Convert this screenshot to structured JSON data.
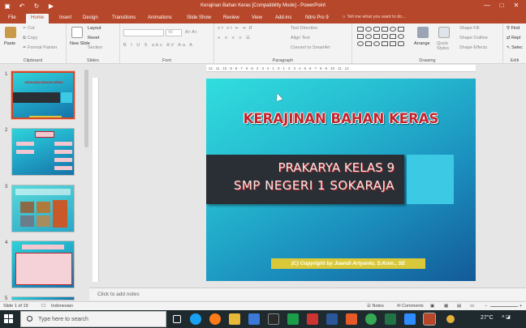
{
  "window": {
    "title": "Kerajinan Bahan Keras [Compatibility Mode] - PowerPoint",
    "controls": [
      "—",
      "□",
      "✕"
    ]
  },
  "qat": {
    "autosave": "▣",
    "undo": "↶",
    "redo": "↻",
    "present": "▶"
  },
  "menu": {
    "file": "File",
    "tabs": [
      "Home",
      "Insert",
      "Design",
      "Transitions",
      "Animations",
      "Slide Show",
      "Review",
      "View",
      "Add-ins",
      "Nitro Pro 9"
    ],
    "active_tab": "Home",
    "tell_me": "Tell me what you want to do..."
  },
  "ribbon": {
    "clipboard": {
      "label": "Clipboard",
      "paste": "Paste",
      "cut": "Cut",
      "copy": "Copy",
      "format_painter": "Format Painter"
    },
    "slides": {
      "label": "Slides",
      "new_slide": "New Slide",
      "layout": "Layout",
      "reset": "Reset",
      "section": "Section"
    },
    "font": {
      "label": "Font",
      "size_value": "40",
      "buttons": [
        "B",
        "I",
        "U",
        "S",
        "abc",
        "AV",
        "Aa",
        "A"
      ]
    },
    "paragraph": {
      "label": "Paragraph",
      "text_direction": "Text Direction",
      "align_text": "Align Text",
      "convert_smartart": "Convert to SmartArt"
    },
    "drawing": {
      "label": "Drawing",
      "arrange": "Arrange",
      "quick_styles": "Quick Styles",
      "shape_fill": "Shape Fill",
      "shape_outline": "Shape Outline",
      "shape_effects": "Shape Effects"
    },
    "editing": {
      "label": "Editi",
      "find": "Find",
      "replace": "Repl",
      "select": "Selec"
    }
  },
  "thumbnails": [
    {
      "num": "1",
      "selected": true,
      "title": "KERAJINAN BAHAN KERAS"
    },
    {
      "num": "2",
      "selected": false
    },
    {
      "num": "3",
      "selected": false
    },
    {
      "num": "4",
      "selected": false
    },
    {
      "num": "5",
      "selected": false
    }
  ],
  "ruler": {
    "ticks": "· 12 · 11 · 10 · 9 · 8 · 7 · 6 · 5 · 4 · 3 · 2 · 1 · 0 · 1 · 2 · 3 · 4 · 5 · 6 · 7 · 8 · 9 · 10 · 11 · 12 ·"
  },
  "slide": {
    "title": "KERAJINAN BAHAN KERAS",
    "subtitle_line1": "PRAKARYA KELAS 9",
    "subtitle_line2": "SMP NEGERI 1 SOKARAJA",
    "copyright": "(C) Copyright by Juandi Artyanto, S.Kom., SE"
  },
  "notes": {
    "placeholder": "Click to add notes"
  },
  "status": {
    "slide_counter": "Slide 1 of 19",
    "language": "Indonesian",
    "notes": "Notes",
    "comments": "Comments"
  },
  "taskbar": {
    "search_placeholder": "Type here to search",
    "temperature": "27°C"
  },
  "colors": {
    "accent": "#b7472a",
    "title_red": "#c3242c",
    "copyright_bg": "#d9c93a"
  }
}
